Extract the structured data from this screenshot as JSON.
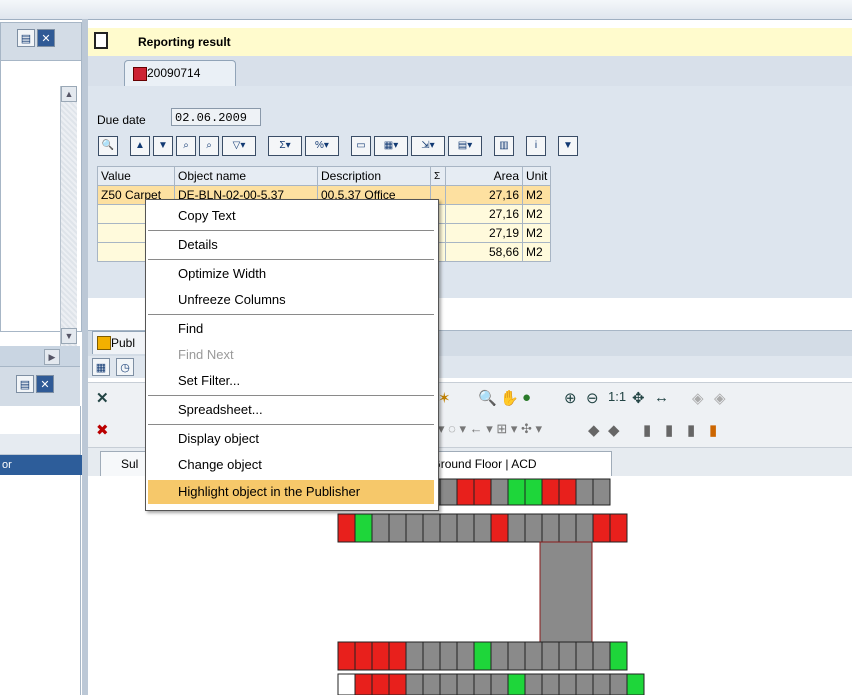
{
  "title": {
    "label": "Reporting result"
  },
  "tab": {
    "label": "20090714"
  },
  "due": {
    "label": "Due date",
    "value": "02.06.2009"
  },
  "table": {
    "headers": [
      "Value",
      "Object name",
      "Description",
      "Σ",
      "Area",
      "Unit"
    ],
    "row1": {
      "value": "Z50 Carpet",
      "object": "DE-BLN-02-00-5.37",
      "description": "00.5.37 Office",
      "area": "27,16",
      "unit": "M2"
    },
    "rows": [
      {
        "area": "27,16",
        "unit": "M2"
      },
      {
        "area": "27,19",
        "unit": "M2"
      },
      {
        "area": "58,66",
        "unit": "M2"
      }
    ]
  },
  "lower": {
    "pub_tab": "Publ",
    "doc_tab1": "Sul",
    "doc_tab2": "rlin Building 02 - Ground Floor | ACD",
    "zoom": "1:1",
    "left_item": "or"
  },
  "menu": {
    "items": [
      "Copy Text",
      "Details",
      "Optimize Width",
      "Unfreeze Columns",
      "Find",
      "Find Next",
      "Set Filter...",
      "Spreadsheet...",
      "Display object",
      "Change object",
      "Highlight object in the Publisher"
    ]
  },
  "colors": {
    "highlight": "#f6c86a",
    "title_bg": "#fffbcd",
    "room_red": "#e8201c",
    "room_green": "#1ed63a",
    "room_gray": "#8a8a8a"
  }
}
